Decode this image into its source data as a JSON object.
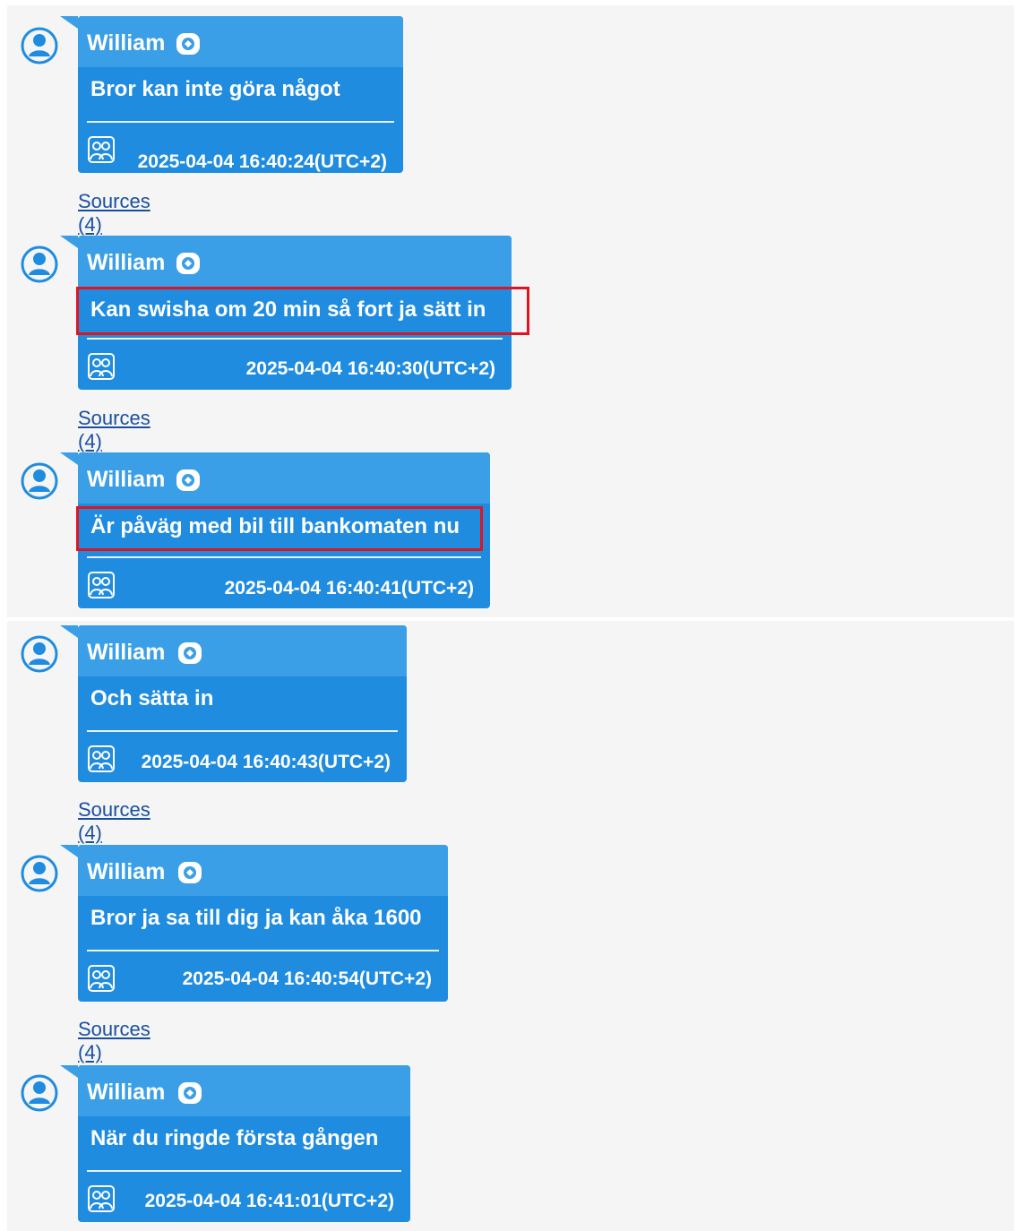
{
  "messages": [
    {
      "sender": "William",
      "text": "Bror kan inte göra något",
      "timestamp": "2025-04-04 16:40:24(UTC+2)",
      "highlighted": false
    },
    {
      "sender": "William",
      "text": "Kan swisha om 20 min så fort ja sätt in",
      "timestamp": "2025-04-04 16:40:30(UTC+2)",
      "highlighted": true
    },
    {
      "sender": "William",
      "text": "Är påväg med bil till bankomaten nu",
      "timestamp": "2025-04-04 16:40:41(UTC+2)",
      "highlighted": true
    },
    {
      "sender": "William",
      "text": "Och sätta in",
      "timestamp": "2025-04-04 16:40:43(UTC+2)",
      "highlighted": false
    },
    {
      "sender": "William",
      "text": "Bror ja sa till dig ja kan åka 1600",
      "timestamp": "2025-04-04 16:40:54(UTC+2)",
      "highlighted": false
    },
    {
      "sender": "William",
      "text": "När du ringde första gången",
      "timestamp": "2025-04-04 16:41:01(UTC+2)",
      "highlighted": false
    }
  ],
  "sources_label": "Sources (4)",
  "icons": {
    "avatar": "user-avatar-icon",
    "head": "app-badge-icon",
    "footer": "group-users-icon"
  },
  "colors": {
    "bubble_body": "#1f8ce0",
    "bubble_header": "#3a9fe6",
    "highlight": "#e0141e",
    "link": "#1a4fa0"
  }
}
